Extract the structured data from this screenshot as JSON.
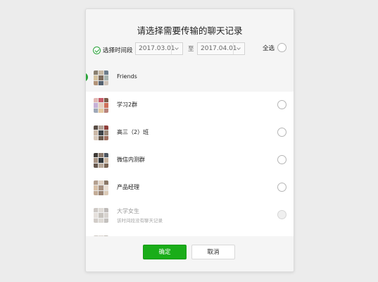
{
  "dialog": {
    "title": "请选择需要传输的聊天记录",
    "time_filter_label": "选择时间段",
    "start_date": "2017.03.01",
    "to_label": "至",
    "end_date": "2017.04.01",
    "select_all_label": "全选"
  },
  "chats": [
    {
      "name": "Friends",
      "selected": true,
      "disabled": false,
      "subtitle": ""
    },
    {
      "name": "学习2群",
      "selected": false,
      "disabled": false,
      "subtitle": ""
    },
    {
      "name": "高三（2）班",
      "selected": false,
      "disabled": false,
      "subtitle": ""
    },
    {
      "name": "微信内测群",
      "selected": false,
      "disabled": false,
      "subtitle": ""
    },
    {
      "name": "产品经理",
      "selected": false,
      "disabled": false,
      "subtitle": ""
    },
    {
      "name": "大学女生",
      "selected": false,
      "disabled": true,
      "subtitle": "该时间段没有聊天记录"
    }
  ],
  "buttons": {
    "confirm": "确定",
    "cancel": "取消"
  },
  "colors": {
    "accent": "#1aad19",
    "check": "#2ba53a"
  }
}
